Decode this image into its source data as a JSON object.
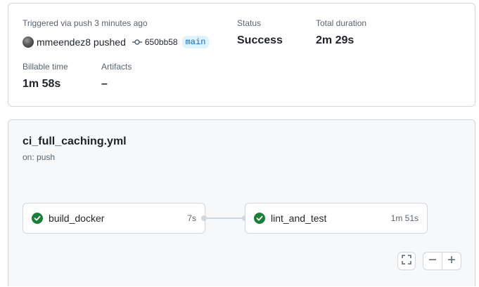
{
  "summary": {
    "trigger_text": "Triggered via push 3 minutes ago",
    "actor": "mmeendez8 pushed",
    "commit_sha": "650bb58",
    "branch": "main",
    "status_label": "Status",
    "status_value": "Success",
    "duration_label": "Total duration",
    "duration_value": "2m 29s",
    "billable_label": "Billable time",
    "billable_value": "1m 58s",
    "artifacts_label": "Artifacts",
    "artifacts_value": "–"
  },
  "workflow": {
    "file": "ci_full_caching.yml",
    "trigger": "on: push",
    "jobs": [
      {
        "name": "build_docker",
        "duration": "7s",
        "status": "success"
      },
      {
        "name": "lint_and_test",
        "duration": "1m 51s",
        "status": "success"
      }
    ]
  },
  "colors": {
    "success": "#1a7f37",
    "branch_text": "#0969da",
    "branch_bg": "#ddf4ff",
    "panel_bg": "#f6f8fa",
    "border": "#d0d7de"
  },
  "icons": [
    "commit-icon",
    "check-circle-icon",
    "fullscreen-icon",
    "zoom-out-icon",
    "zoom-in-icon"
  ]
}
